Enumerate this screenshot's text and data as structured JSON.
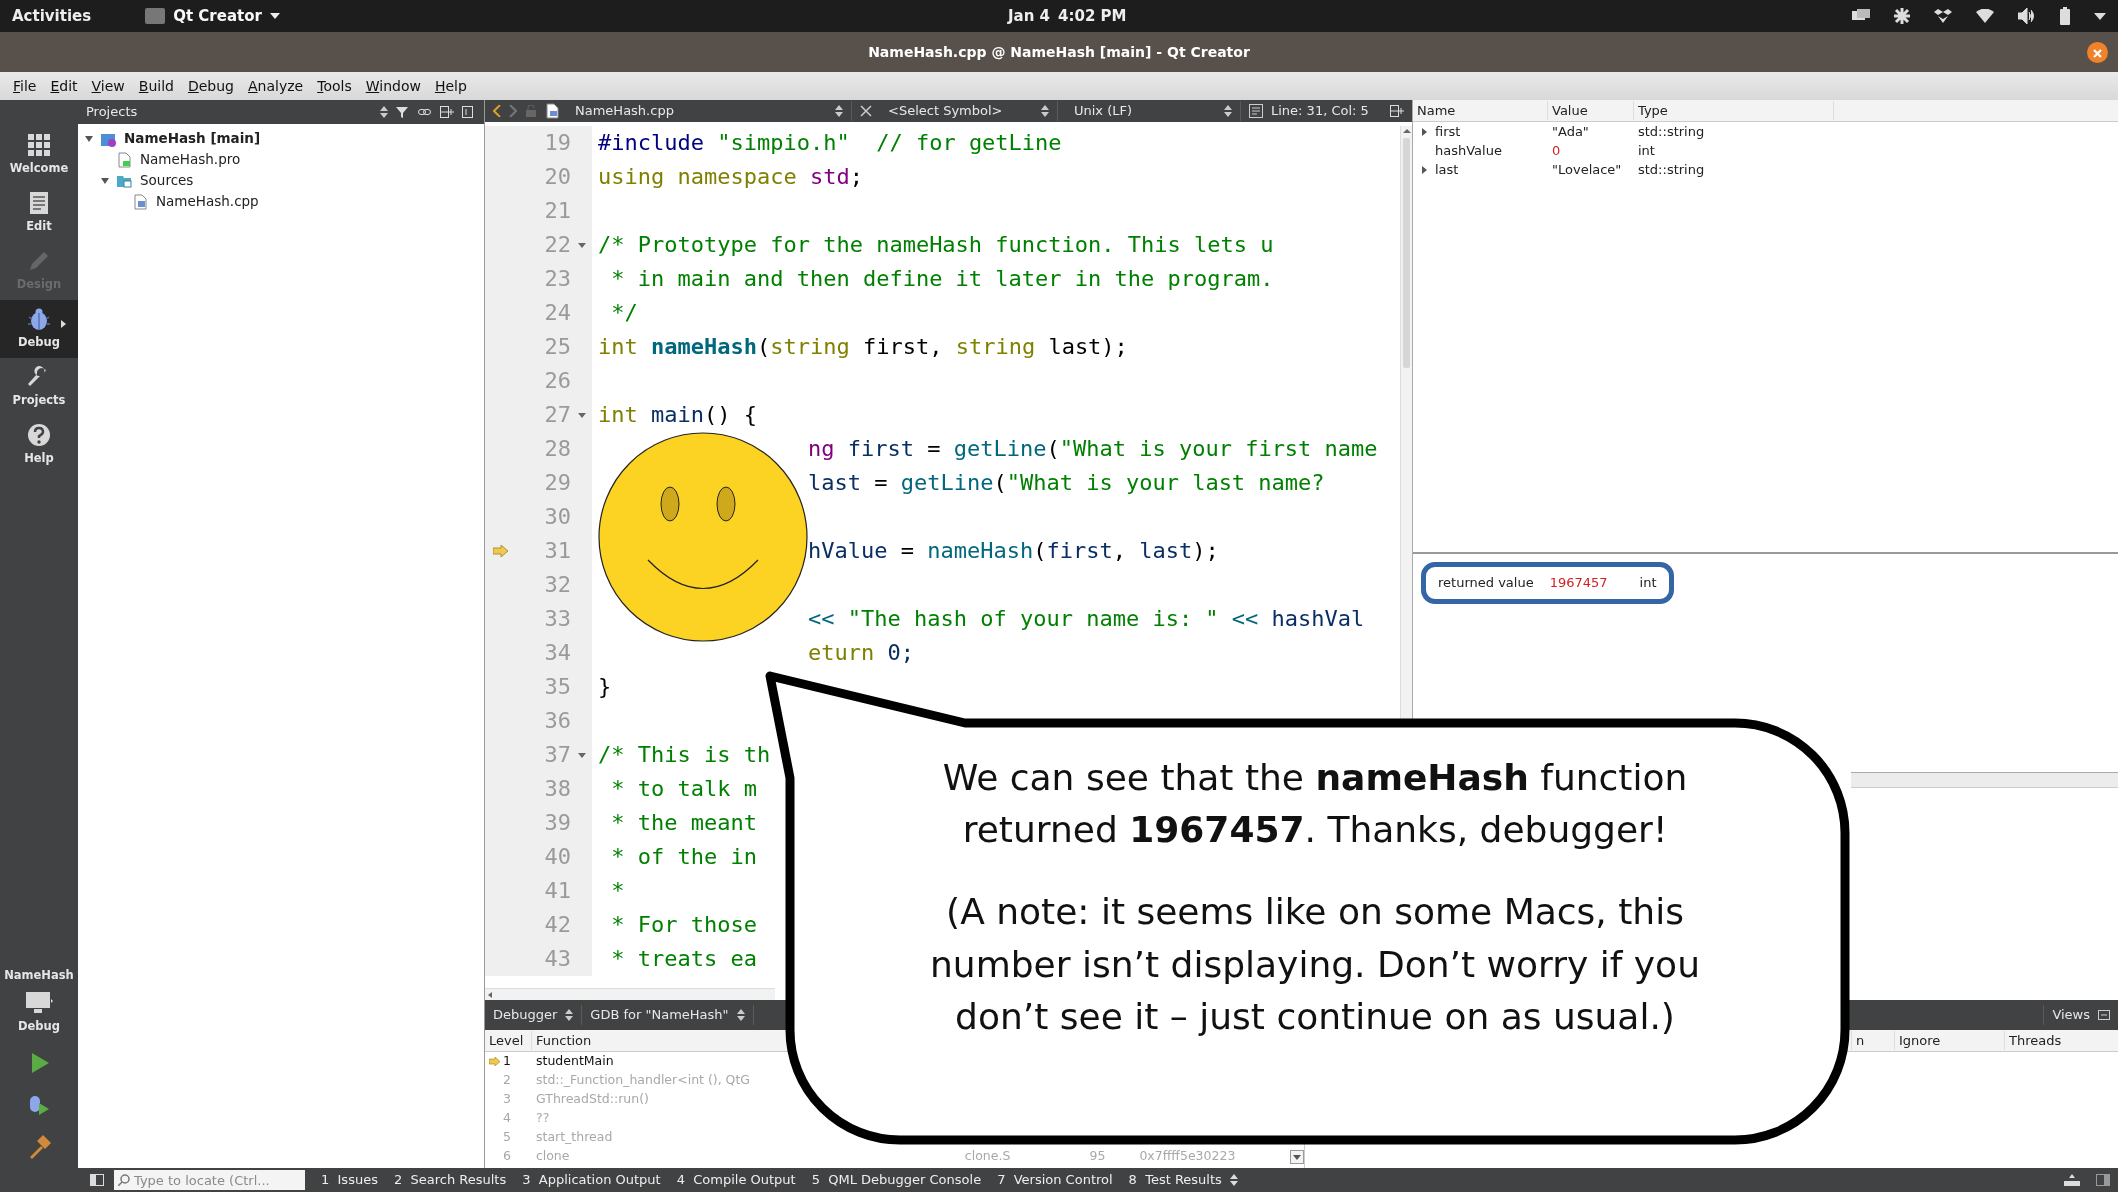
{
  "top_bar": {
    "activities": "Activities",
    "app_menu": "Qt Creator",
    "date": "Jan 4",
    "time": "4:02 PM"
  },
  "window": {
    "title": "NameHash.cpp @ NameHash [main] - Qt Creator"
  },
  "menu": [
    "File",
    "Edit",
    "View",
    "Build",
    "Debug",
    "Analyze",
    "Tools",
    "Window",
    "Help"
  ],
  "mode_bar": {
    "modes": [
      {
        "label": "Welcome",
        "kind": "welcome",
        "selected": false,
        "disabled": false
      },
      {
        "label": "Edit",
        "kind": "edit",
        "selected": false,
        "disabled": false
      },
      {
        "label": "Design",
        "kind": "design",
        "selected": false,
        "disabled": true
      },
      {
        "label": "Debug",
        "kind": "debug",
        "selected": true,
        "disabled": false
      },
      {
        "label": "Projects",
        "kind": "projects",
        "selected": false,
        "disabled": false
      },
      {
        "label": "Help",
        "kind": "help",
        "selected": false,
        "disabled": false
      }
    ],
    "project_label": "NameHash",
    "target_label": "Debug"
  },
  "projects": {
    "title": "Projects",
    "tree": [
      {
        "label": "NameHash [main]",
        "kind": "project",
        "expanded": true,
        "children": [
          {
            "label": "NameHash.pro",
            "kind": "profile"
          },
          {
            "label": "Sources",
            "kind": "folder",
            "expanded": true,
            "children": [
              {
                "label": "NameHash.cpp",
                "kind": "source"
              }
            ]
          }
        ]
      }
    ]
  },
  "editor": {
    "file": "NameHash.cpp",
    "symbol": "<Select Symbol>",
    "line_ending": "Unix (LF)",
    "position": "Line: 31, Col: 5",
    "lines": [
      {
        "number": "19",
        "current": false,
        "fold": false,
        "segments": [
          {
            "text": "#include ",
            "kind": "pp"
          },
          {
            "text": "\"simpio.h\"",
            "kind": "str"
          },
          {
            "text": "  // for getLine",
            "kind": "cmt"
          }
        ]
      },
      {
        "number": "20",
        "current": false,
        "fold": false,
        "segments": [
          {
            "text": "using namespace ",
            "kind": "kw"
          },
          {
            "text": "std",
            "kind": "std"
          },
          {
            "text": ";",
            "kind": "plain"
          }
        ]
      },
      {
        "number": "21",
        "current": false,
        "fold": false
      },
      {
        "number": "22",
        "current": false,
        "fold": true,
        "segments": [
          {
            "text": "/* Prototype for the nameHash function. This lets u",
            "kind": "cmt"
          }
        ]
      },
      {
        "number": "23",
        "current": false,
        "fold": false,
        "segments": [
          {
            "text": " * in main and then define it later in the program.",
            "kind": "cmt"
          }
        ]
      },
      {
        "number": "24",
        "current": false,
        "fold": false,
        "segments": [
          {
            "text": " */",
            "kind": "cmt"
          }
        ]
      },
      {
        "number": "25",
        "current": false,
        "fold": false,
        "segments": [
          {
            "text": "int ",
            "kind": "kw"
          },
          {
            "text": "nameHash",
            "kind": "fn"
          },
          {
            "text": "(",
            "kind": "plain"
          },
          {
            "text": "string",
            "kind": "kw"
          },
          {
            "text": " first, ",
            "kind": "plain"
          },
          {
            "text": "string",
            "kind": "kw"
          },
          {
            "text": " last);",
            "kind": "plain"
          }
        ]
      },
      {
        "number": "26",
        "current": false,
        "fold": false
      },
      {
        "number": "27",
        "current": false,
        "fold": true,
        "segments": [
          {
            "text": "int ",
            "kind": "kw"
          },
          {
            "text": "main",
            "kind": "var"
          },
          {
            "text": "() {",
            "kind": "plain"
          }
        ]
      },
      {
        "number": "28",
        "current": false,
        "fold": false,
        "segments": [
          {
            "text": "ng",
            "kind": "std"
          },
          {
            "text": " first",
            "kind": "var"
          },
          {
            "text": " = ",
            "kind": "plain"
          },
          {
            "text": "getLine",
            "kind": "call"
          },
          {
            "text": "(",
            "kind": "plain"
          },
          {
            "text": "\"What is your first name",
            "kind": "str"
          }
        ]
      },
      {
        "number": "29",
        "current": false,
        "fold": false,
        "segments": [
          {
            "text": "last",
            "kind": "var"
          },
          {
            "text": " = ",
            "kind": "plain"
          },
          {
            "text": "getLine",
            "kind": "call"
          },
          {
            "text": "(",
            "kind": "plain"
          },
          {
            "text": "\"What is your last name?",
            "kind": "str"
          }
        ]
      },
      {
        "number": "30",
        "current": false,
        "fold": false
      },
      {
        "number": "31",
        "current": true,
        "fold": false,
        "segments": [
          {
            "text": "hValue",
            "kind": "var"
          },
          {
            "text": " = ",
            "kind": "plain"
          },
          {
            "text": "nameHash",
            "kind": "call"
          },
          {
            "text": "(",
            "kind": "plain"
          },
          {
            "text": "first",
            "kind": "var"
          },
          {
            "text": ", ",
            "kind": "plain"
          },
          {
            "text": "last",
            "kind": "var"
          },
          {
            "text": ");",
            "kind": "plain"
          }
        ]
      },
      {
        "number": "32",
        "current": false,
        "fold": false
      },
      {
        "number": "33",
        "current": false,
        "fold": false,
        "segments": [
          {
            "text": "<< ",
            "kind": "call"
          },
          {
            "text": "\"The hash of your name is: \"",
            "kind": "str"
          },
          {
            "text": " << ",
            "kind": "call"
          },
          {
            "text": "hashVal",
            "kind": "var"
          }
        ]
      },
      {
        "number": "34",
        "current": false,
        "fold": false,
        "segments": [
          {
            "text": "eturn ",
            "kind": "kw"
          },
          {
            "text": "0;",
            "kind": "var"
          }
        ]
      },
      {
        "number": "35",
        "current": false,
        "fold": false,
        "segments": [
          {
            "text": "}",
            "kind": "plain"
          }
        ]
      },
      {
        "number": "36",
        "current": false,
        "fold": false
      },
      {
        "number": "37",
        "current": false,
        "fold": true,
        "segments": [
          {
            "text": "/* This is th",
            "kind": "cmt"
          }
        ]
      },
      {
        "number": "38",
        "current": false,
        "fold": false,
        "segments": [
          {
            "text": " * to talk m",
            "kind": "cmt"
          }
        ]
      },
      {
        "number": "39",
        "current": false,
        "fold": false,
        "segments": [
          {
            "text": " * the meant",
            "kind": "cmt"
          }
        ]
      },
      {
        "number": "40",
        "current": false,
        "fold": false,
        "segments": [
          {
            "text": " * of the in",
            "kind": "cmt"
          }
        ]
      },
      {
        "number": "41",
        "current": false,
        "fold": false,
        "segments": [
          {
            "text": " *",
            "kind": "cmt"
          }
        ]
      },
      {
        "number": "42",
        "current": false,
        "fold": false,
        "segments": [
          {
            "text": " * For those",
            "kind": "cmt"
          }
        ]
      },
      {
        "number": "43",
        "current": false,
        "fold": false,
        "segments": [
          {
            "text": " * treats ea",
            "kind": "cmt"
          }
        ]
      }
    ]
  },
  "locals": {
    "columns": [
      "Name",
      "Value",
      "Type"
    ],
    "rows": [
      {
        "name": "first",
        "value": "\"Ada\"",
        "type": "std::string",
        "expandable": true,
        "changed": false
      },
      {
        "name": "hashValue",
        "value": "0",
        "type": "int",
        "expandable": false,
        "changed": true
      },
      {
        "name": "last",
        "value": "\"Lovelace\"",
        "type": "std::string",
        "expandable": true,
        "changed": false
      }
    ]
  },
  "return_value": {
    "name": "returned value",
    "value": "1967457",
    "type": "int"
  },
  "debug_panel": {
    "tool": "Debugger",
    "engine": "GDB for \"NameHash\"",
    "views": "Views",
    "stack": {
      "columns": [
        "Level",
        "Function"
      ],
      "rows": [
        {
          "level": "1",
          "function": "studentMain",
          "current": true,
          "dimmed": false
        },
        {
          "level": "2",
          "function": "std::_Function_handler<int (), QtG",
          "current": false,
          "dimmed": true
        },
        {
          "level": "3",
          "function": "GThreadStd::run()",
          "current": false,
          "dimmed": true
        },
        {
          "level": "4",
          "function": "??",
          "current": false,
          "dimmed": true
        },
        {
          "level": "5",
          "function": "start_thread",
          "current": false,
          "dimmed": true
        },
        {
          "level": "6",
          "function": "clone",
          "file": "clone.S",
          "line": "95",
          "address": "0x7ffff5e30223",
          "current": false,
          "dimmed": true
        }
      ]
    },
    "breakpoints": {
      "columns": [
        "n",
        "Ignore",
        "Threads"
      ]
    }
  },
  "callout": {
    "paragraphs": [
      "We can see that the **nameHash** function returned **1967457**. Thanks, debugger!",
      "(A note: it seems like on some Macs, this number isn’t displaying. Don’t worry if you don’t see it – just continue on as usual.)"
    ]
  },
  "status_bar": {
    "sidebar_shown": true,
    "locator_placeholder": "Type to locate (Ctrl...",
    "panes": [
      {
        "number": "1",
        "label": "Issues"
      },
      {
        "number": "2",
        "label": "Search Results"
      },
      {
        "number": "3",
        "label": "Application Output"
      },
      {
        "number": "4",
        "label": "Compile Output"
      },
      {
        "number": "5",
        "label": "QML Debugger Console"
      },
      {
        "number": "7",
        "label": "Version Control"
      },
      {
        "number": "8",
        "label": "Test Results"
      }
    ]
  }
}
